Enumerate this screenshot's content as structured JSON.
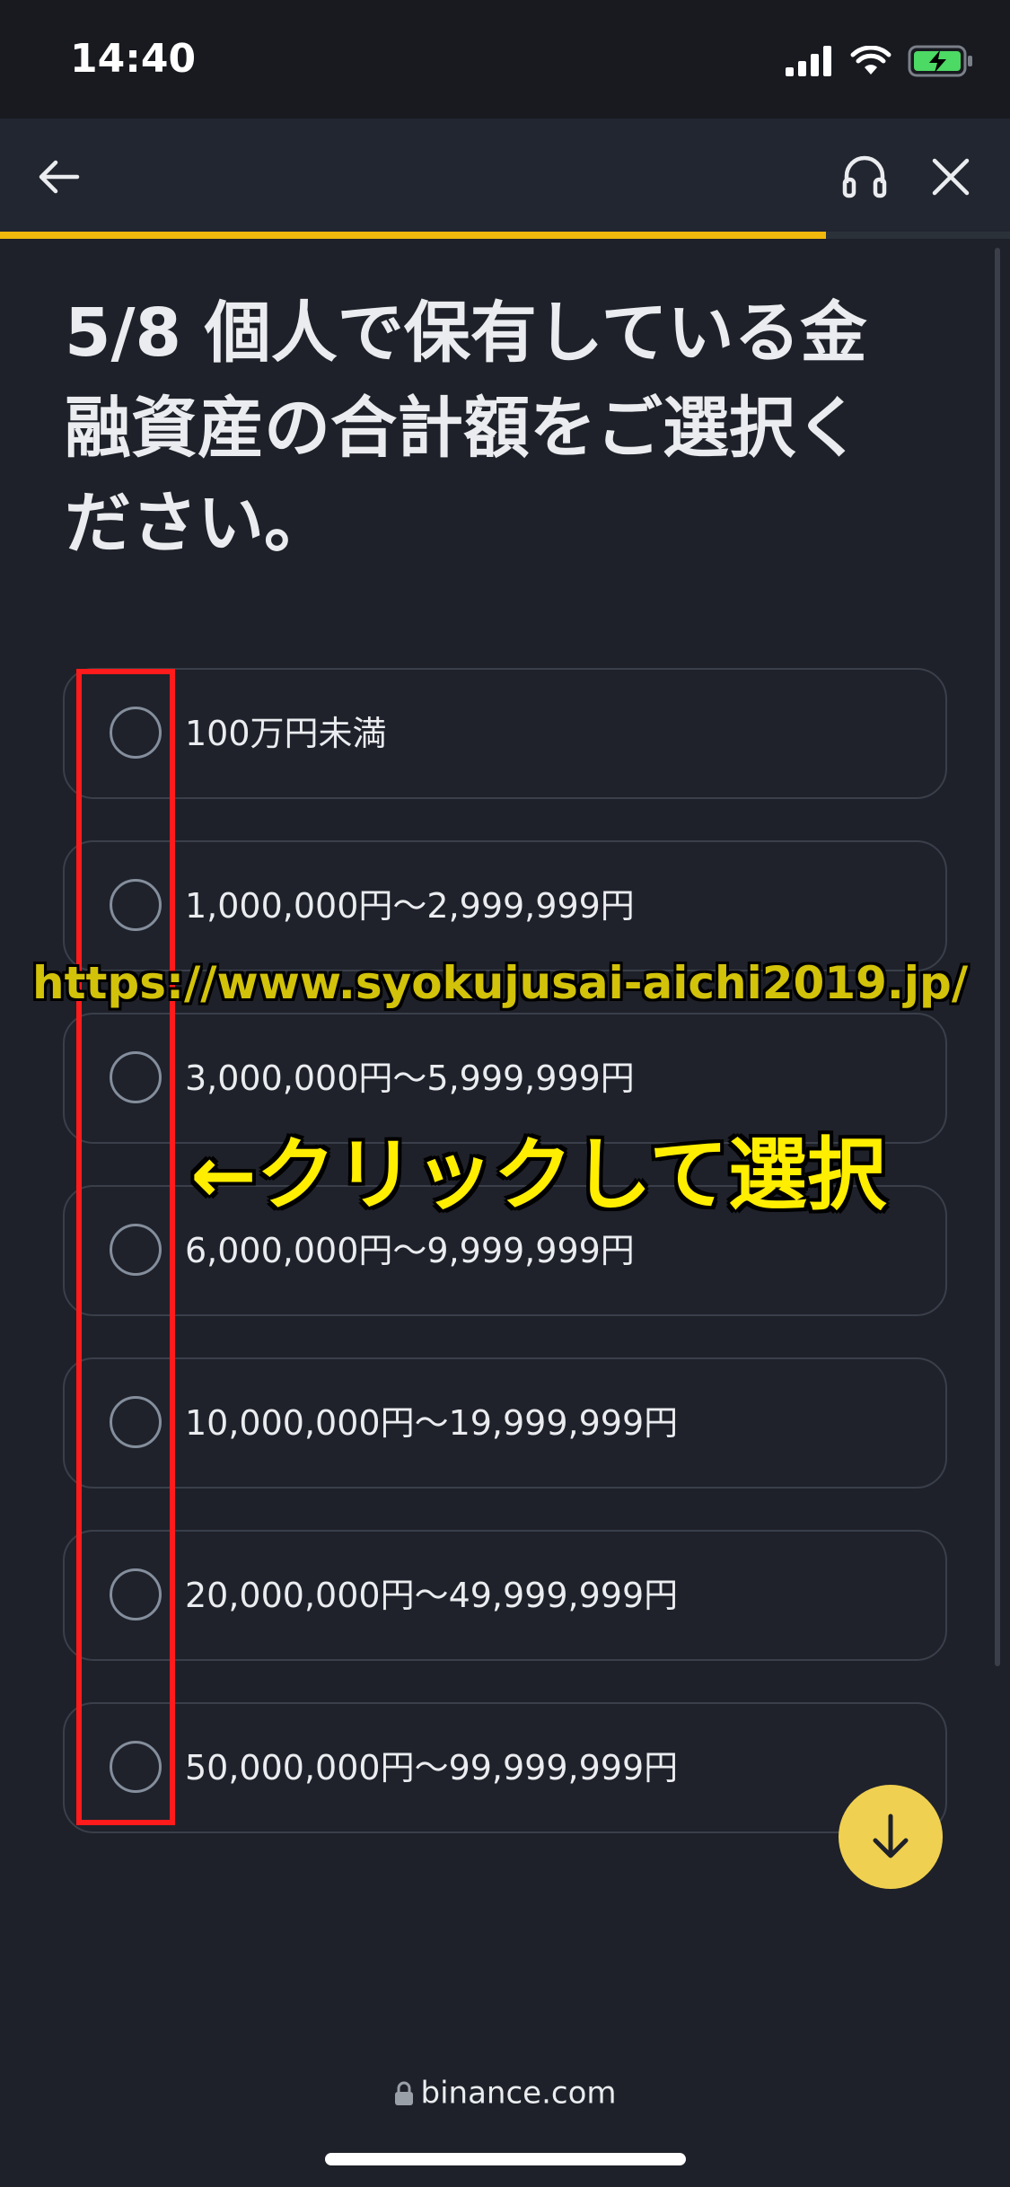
{
  "status": {
    "time": "14:40"
  },
  "progress": {
    "fraction": 0.8178
  },
  "question": {
    "text": "5/8 個人で保有している金融資産の合計額をご選択ください。"
  },
  "options": [
    {
      "label": "100万円未満"
    },
    {
      "label": "1,000,000円～2,999,999円"
    },
    {
      "label": "3,000,000円～5,999,999円"
    },
    {
      "label": "6,000,000円～9,999,999円"
    },
    {
      "label": "10,000,000円～19,999,999円"
    },
    {
      "label": "20,000,000円～49,999,999円"
    },
    {
      "label": "50,000,000円～99,999,999円"
    }
  ],
  "annotations": {
    "watermark": "https://www.syokujusai-aichi2019.jp/",
    "click_hint": "←クリックして選択"
  },
  "url": "binance.com",
  "icons": {
    "back": "arrow-left-icon",
    "support": "headset-icon",
    "close": "close-icon",
    "scroll": "arrow-down-icon",
    "lock": "lock-icon"
  },
  "colors": {
    "accent": "#f0b90b",
    "highlight": "#ff1b1b",
    "annotation": "#ffee00"
  }
}
